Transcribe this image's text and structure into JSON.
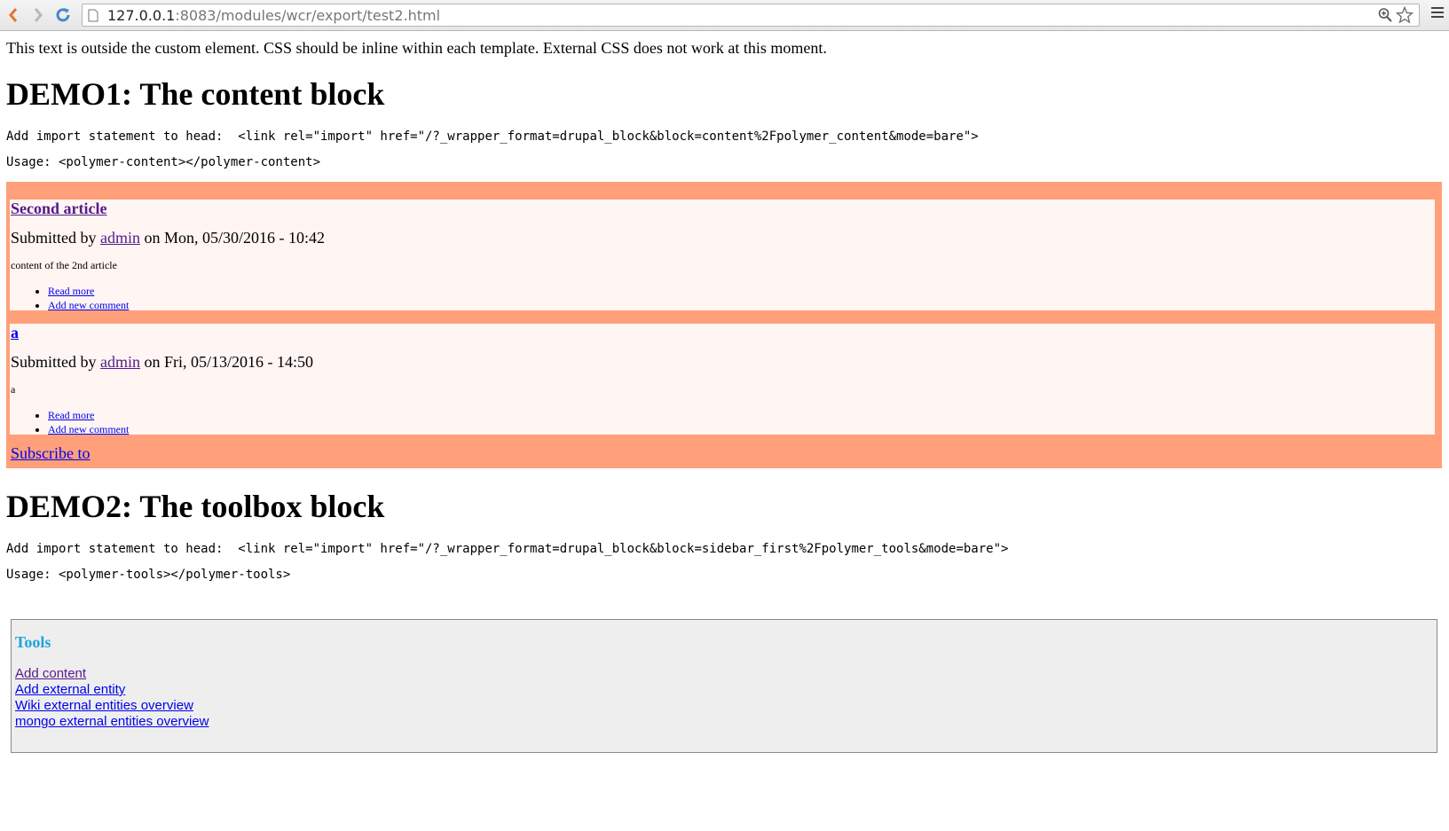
{
  "browser": {
    "url_host": "127.0.0.1",
    "url_rest": ":8083/modules/wcr/export/test2.html"
  },
  "intro": "This text is outside the custom element. CSS should be inline within each template. External CSS does not work at this moment.",
  "demo1": {
    "heading": "DEMO1: The content block",
    "import_line": "Add import statement to head:  <link rel=\"import\" href=\"/?_wrapper_format=drupal_block&block=content%2Fpolymer_content&mode=bare\">",
    "usage_line": "Usage: <polymer-content></polymer-content>",
    "articles": [
      {
        "title": "Second article",
        "submitted_prefix": "Submitted by ",
        "author": "admin",
        "submitted_suffix": " on Mon, 05/30/2016 - 10:42",
        "body": "content of the 2nd article",
        "read_more": "Read more",
        "add_comment": "Add new comment"
      },
      {
        "title": "a",
        "submitted_prefix": "Submitted by ",
        "author": "admin",
        "submitted_suffix": " on Fri, 05/13/2016 - 14:50",
        "body": "a",
        "read_more": "Read more",
        "add_comment": "Add new comment"
      }
    ],
    "subscribe": "Subscribe to"
  },
  "demo2": {
    "heading": "DEMO2: The toolbox block",
    "import_line": "Add import statement to head:  <link rel=\"import\" href=\"/?_wrapper_format=drupal_block&block=sidebar_first%2Fpolymer_tools&mode=bare\">",
    "usage_line": "Usage: <polymer-tools></polymer-tools>",
    "tools_title": "Tools",
    "tool_links": [
      "Add content",
      "Add external entity",
      "Wiki external entities overview",
      "mongo external entities overview"
    ]
  },
  "colors": {
    "content_bg": "#ffa07a",
    "article_bg": "#fff5f3",
    "tools_bg": "#eeeeee",
    "tools_title": "#1ea3dc"
  }
}
